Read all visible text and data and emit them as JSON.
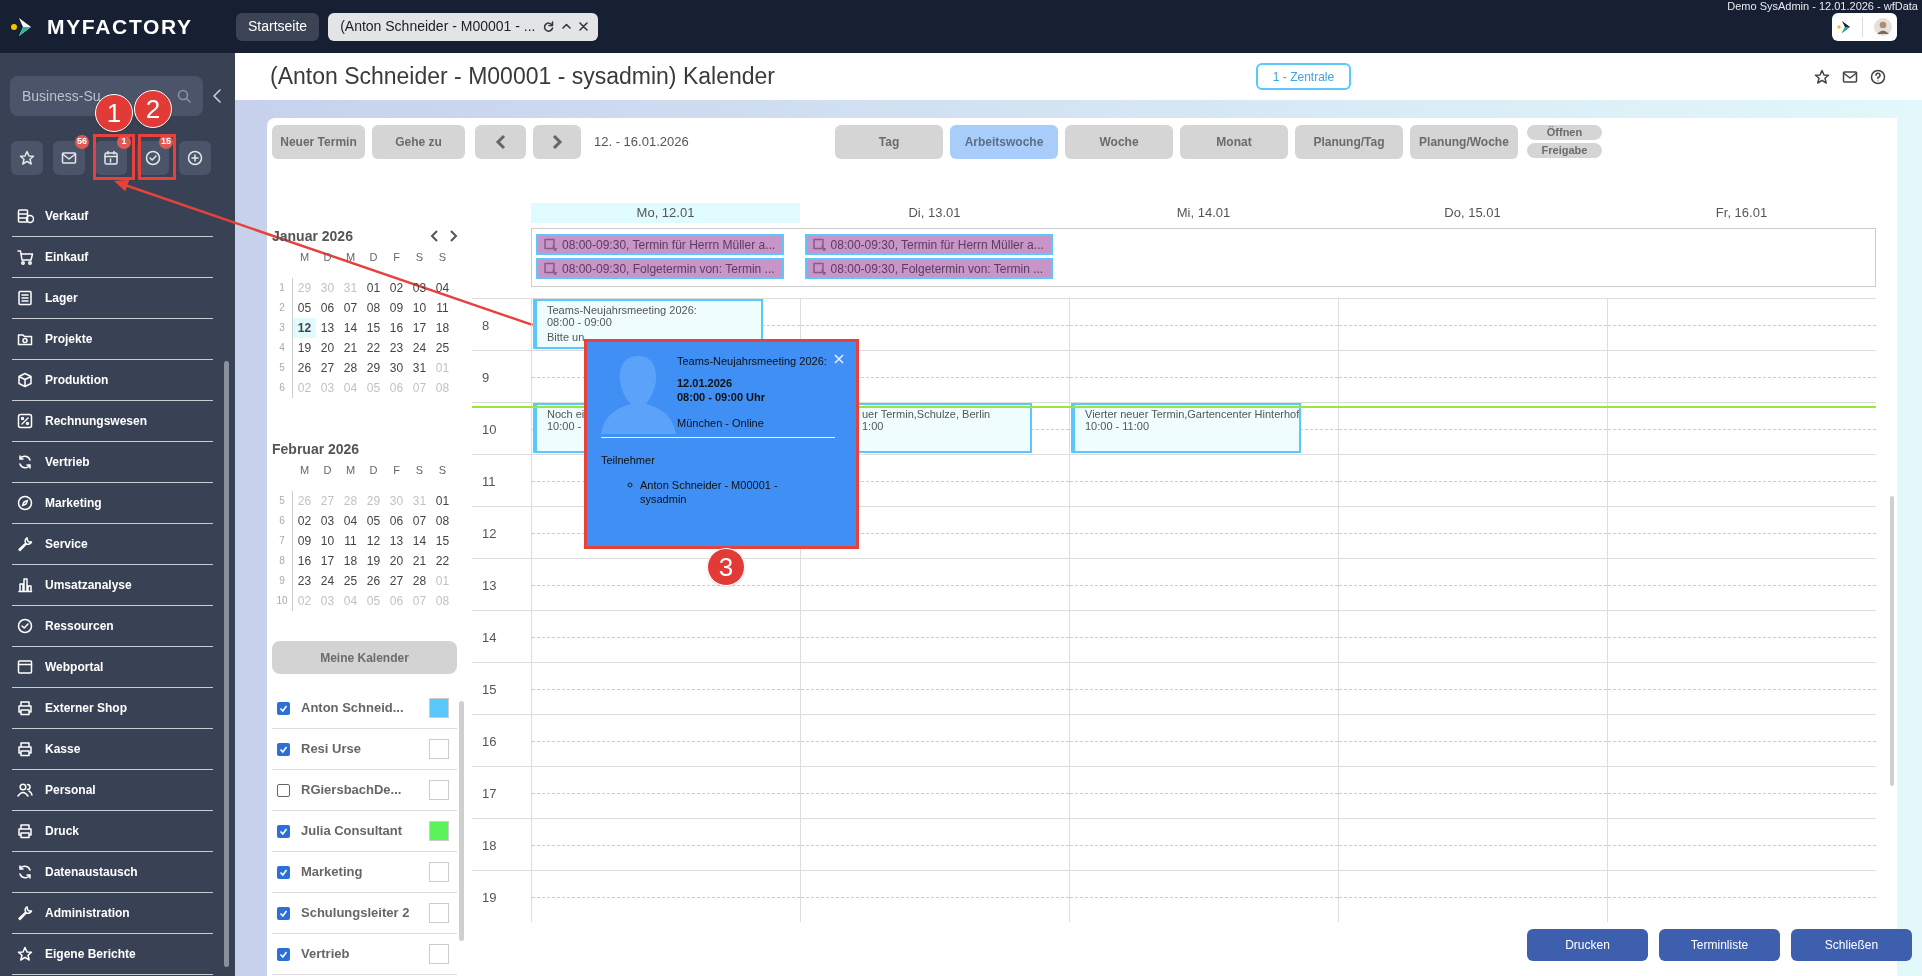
{
  "app": {
    "logo": "MYFACTORY",
    "user_info": "Demo SysAdmin - 12.01.2026 - wfData"
  },
  "tabs": [
    {
      "label": "Startseite",
      "selected": false
    },
    {
      "label": "(Anton Schneider - M00001 - ...",
      "selected": true
    }
  ],
  "sidebar": {
    "search": {
      "placeholder": "Business-Su"
    },
    "quick_buttons": [
      {
        "kind": "star"
      },
      {
        "kind": "mail",
        "badge": "56"
      },
      {
        "kind": "calendar",
        "badge": "1"
      },
      {
        "kind": "tasks",
        "badge": "15"
      },
      {
        "kind": "add"
      }
    ],
    "menu": [
      "Verkauf",
      "Einkauf",
      "Lager",
      "Projekte",
      "Produktion",
      "Rechnungswesen",
      "Vertrieb",
      "Marketing",
      "Service",
      "Umsatzanalyse",
      "Ressourcen",
      "Webportal",
      "Externer Shop",
      "Kasse",
      "Personal",
      "Druck",
      "Datenaustausch",
      "Administration",
      "Eigene Berichte"
    ]
  },
  "header": {
    "title": "(Anton Schneider - M00001 - sysadmin) Kalender",
    "location": "1 - Zentrale"
  },
  "toolbar": {
    "buttons": [
      "Neuer Termin",
      "Gehe zu"
    ],
    "range": "12. - 16.01.2026",
    "views": [
      {
        "label": "Tag",
        "selected": false
      },
      {
        "label": "Arbeitswoche",
        "selected": true
      },
      {
        "label": "Woche",
        "selected": false
      },
      {
        "label": "Monat",
        "selected": false
      },
      {
        "label": "Planung/Tag",
        "selected": false
      },
      {
        "label": "Planung/Woche",
        "selected": false
      }
    ],
    "extra": [
      "Öffnen",
      "Freigabe"
    ]
  },
  "mini_calendars": [
    {
      "title": "Januar 2026",
      "weekdays": [
        "M",
        "D",
        "M",
        "D",
        "F",
        "S",
        "S"
      ],
      "weeks": [
        {
          "num": "1",
          "days": [
            {
              "t": "29",
              "out": true,
              "today": false
            },
            {
              "t": "30",
              "out": true,
              "today": false
            },
            {
              "t": "31",
              "out": true,
              "today": false
            },
            {
              "t": "01",
              "out": false,
              "today": false
            },
            {
              "t": "02",
              "out": false,
              "today": false
            },
            {
              "t": "03",
              "out": false,
              "today": false
            },
            {
              "t": "04",
              "out": false,
              "today": false
            }
          ]
        },
        {
          "num": "2",
          "days": [
            {
              "t": "05",
              "out": false,
              "today": false
            },
            {
              "t": "06",
              "out": false,
              "today": false
            },
            {
              "t": "07",
              "out": false,
              "today": false
            },
            {
              "t": "08",
              "out": false,
              "today": false
            },
            {
              "t": "09",
              "out": false,
              "today": false
            },
            {
              "t": "10",
              "out": false,
              "today": false
            },
            {
              "t": "11",
              "out": false,
              "today": false
            }
          ]
        },
        {
          "num": "3",
          "days": [
            {
              "t": "12",
              "out": false,
              "today": true
            },
            {
              "t": "13",
              "out": false,
              "today": false
            },
            {
              "t": "14",
              "out": false,
              "today": false
            },
            {
              "t": "15",
              "out": false,
              "today": false
            },
            {
              "t": "16",
              "out": false,
              "today": false
            },
            {
              "t": "17",
              "out": false,
              "today": false
            },
            {
              "t": "18",
              "out": false,
              "today": false
            }
          ]
        },
        {
          "num": "4",
          "days": [
            {
              "t": "19",
              "out": false,
              "today": false
            },
            {
              "t": "20",
              "out": false,
              "today": false
            },
            {
              "t": "21",
              "out": false,
              "today": false
            },
            {
              "t": "22",
              "out": false,
              "today": false
            },
            {
              "t": "23",
              "out": false,
              "today": false
            },
            {
              "t": "24",
              "out": false,
              "today": false
            },
            {
              "t": "25",
              "out": false,
              "today": false
            }
          ]
        },
        {
          "num": "5",
          "days": [
            {
              "t": "26",
              "out": false,
              "today": false
            },
            {
              "t": "27",
              "out": false,
              "today": false
            },
            {
              "t": "28",
              "out": false,
              "today": false
            },
            {
              "t": "29",
              "out": false,
              "today": false
            },
            {
              "t": "30",
              "out": false,
              "today": false
            },
            {
              "t": "31",
              "out": false,
              "today": false
            },
            {
              "t": "01",
              "out": true,
              "today": false
            }
          ]
        },
        {
          "num": "6",
          "days": [
            {
              "t": "02",
              "out": true,
              "today": false
            },
            {
              "t": "03",
              "out": true,
              "today": false
            },
            {
              "t": "04",
              "out": true,
              "today": false
            },
            {
              "t": "05",
              "out": true,
              "today": false
            },
            {
              "t": "06",
              "out": true,
              "today": false
            },
            {
              "t": "07",
              "out": true,
              "today": false
            },
            {
              "t": "08",
              "out": true,
              "today": false
            }
          ]
        }
      ]
    },
    {
      "title": "Februar 2026",
      "weekdays": [
        "M",
        "D",
        "M",
        "D",
        "F",
        "S",
        "S"
      ],
      "weeks": [
        {
          "num": "5",
          "days": [
            {
              "t": "26",
              "out": true,
              "today": false
            },
            {
              "t": "27",
              "out": true,
              "today": false
            },
            {
              "t": "28",
              "out": true,
              "today": false
            },
            {
              "t": "29",
              "out": true,
              "today": false
            },
            {
              "t": "30",
              "out": true,
              "today": false
            },
            {
              "t": "31",
              "out": true,
              "today": false
            },
            {
              "t": "01",
              "out": false,
              "today": false
            }
          ]
        },
        {
          "num": "6",
          "days": [
            {
              "t": "02",
              "out": false,
              "today": false
            },
            {
              "t": "03",
              "out": false,
              "today": false
            },
            {
              "t": "04",
              "out": false,
              "today": false
            },
            {
              "t": "05",
              "out": false,
              "today": false
            },
            {
              "t": "06",
              "out": false,
              "today": false
            },
            {
              "t": "07",
              "out": false,
              "today": false
            },
            {
              "t": "08",
              "out": false,
              "today": false
            }
          ]
        },
        {
          "num": "7",
          "days": [
            {
              "t": "09",
              "out": false,
              "today": false
            },
            {
              "t": "10",
              "out": false,
              "today": false
            },
            {
              "t": "11",
              "out": false,
              "today": false
            },
            {
              "t": "12",
              "out": false,
              "today": false
            },
            {
              "t": "13",
              "out": false,
              "today": false
            },
            {
              "t": "14",
              "out": false,
              "today": false
            },
            {
              "t": "15",
              "out": false,
              "today": false
            }
          ]
        },
        {
          "num": "8",
          "days": [
            {
              "t": "16",
              "out": false,
              "today": false
            },
            {
              "t": "17",
              "out": false,
              "today": false
            },
            {
              "t": "18",
              "out": false,
              "today": false
            },
            {
              "t": "19",
              "out": false,
              "today": false
            },
            {
              "t": "20",
              "out": false,
              "today": false
            },
            {
              "t": "21",
              "out": false,
              "today": false
            },
            {
              "t": "22",
              "out": false,
              "today": false
            }
          ]
        },
        {
          "num": "9",
          "days": [
            {
              "t": "23",
              "out": false,
              "today": false
            },
            {
              "t": "24",
              "out": false,
              "today": false
            },
            {
              "t": "25",
              "out": false,
              "today": false
            },
            {
              "t": "26",
              "out": false,
              "today": false
            },
            {
              "t": "27",
              "out": false,
              "today": false
            },
            {
              "t": "28",
              "out": false,
              "today": false
            },
            {
              "t": "01",
              "out": true,
              "today": false
            }
          ]
        },
        {
          "num": "10",
          "days": [
            {
              "t": "02",
              "out": true,
              "today": false
            },
            {
              "t": "03",
              "out": true,
              "today": false
            },
            {
              "t": "04",
              "out": true,
              "today": false
            },
            {
              "t": "05",
              "out": true,
              "today": false
            },
            {
              "t": "06",
              "out": true,
              "today": false
            },
            {
              "t": "07",
              "out": true,
              "today": false
            },
            {
              "t": "08",
              "out": true,
              "today": false
            }
          ]
        }
      ]
    }
  ],
  "my_calendars": {
    "button": "Meine Kalender",
    "items": [
      {
        "name": "Anton Schneid...",
        "checked": true,
        "color": "#5bc8fb"
      },
      {
        "name": "Resi Urse",
        "checked": true,
        "color": "#ffffff"
      },
      {
        "name": "RGiersbachDe...",
        "checked": false,
        "color": "#ffffff"
      },
      {
        "name": "Julia Consultant",
        "checked": true,
        "color": "#5cf25c"
      },
      {
        "name": "Marketing",
        "checked": true,
        "color": "#ffffff"
      },
      {
        "name": "Schulungsleiter 2",
        "checked": true,
        "color": "#ffffff"
      },
      {
        "name": "Vertrieb",
        "checked": true,
        "color": "#ffffff"
      }
    ]
  },
  "hours": [
    {
      "label": "8",
      "cells": [
        {
          "events": [
            {
              "title": "Teams-Neujahrsmeeting 2026:",
              "time": "08:00 - 09:00",
              "note": "Bitte un",
              "hidden_left": false
            }
          ]
        }
      ]
    },
    {
      "label": "9"
    },
    {
      "label": "10",
      "cells": [
        {
          "events": [
            {
              "title": "Noch ei",
              "time": "10:00 -",
              "hidden_left": false
            }
          ]
        },
        {
          "events": [
            {
              "title": "uer Termin,Schulze, Berlin",
              "time": "1:00",
              "hidden_left": true
            }
          ]
        },
        {
          "events": [
            {
              "title": "Vierter neuer Termin,Gartencenter Hinterhof",
              "time": "10:00 - 11:00",
              "hidden_left": false
            }
          ]
        }
      ]
    },
    {
      "label": "11"
    },
    {
      "label": "12"
    },
    {
      "label": "13"
    },
    {
      "label": "14"
    },
    {
      "label": "15"
    },
    {
      "label": "16"
    },
    {
      "label": "17"
    },
    {
      "label": "18"
    },
    {
      "label": "19"
    }
  ],
  "days": [
    {
      "label": "Mo, 12.01",
      "selected": true,
      "all_day": [
        "08:00-09:30, Termin für Herrn Müller a...",
        "08:00-09:30, Folgetermin von: Termin ..."
      ]
    },
    {
      "label": "Di, 13.01",
      "selected": false,
      "all_day": [
        "08:00-09:30, Termin für Herrn Müller a...",
        "08:00-09:30, Folgetermin von: Termin ..."
      ]
    },
    {
      "label": "Mi, 14.01",
      "selected": false
    },
    {
      "label": "Do, 15.01",
      "selected": false
    },
    {
      "label": "Fr, 16.01",
      "selected": false
    }
  ],
  "popup": {
    "title": "Teams-Neujahrsmeeting 2026:",
    "date": "12.01.2026",
    "time": "08:00 - 09:00 Uhr",
    "location": "München - Online",
    "section": "Teilnehmer",
    "participants": [
      "Anton Schneider - M00001 - sysadmin"
    ]
  },
  "footer_buttons": [
    "Drucken",
    "Terminliste",
    "Schließen"
  ],
  "annotations": [
    "1",
    "2",
    "3"
  ]
}
